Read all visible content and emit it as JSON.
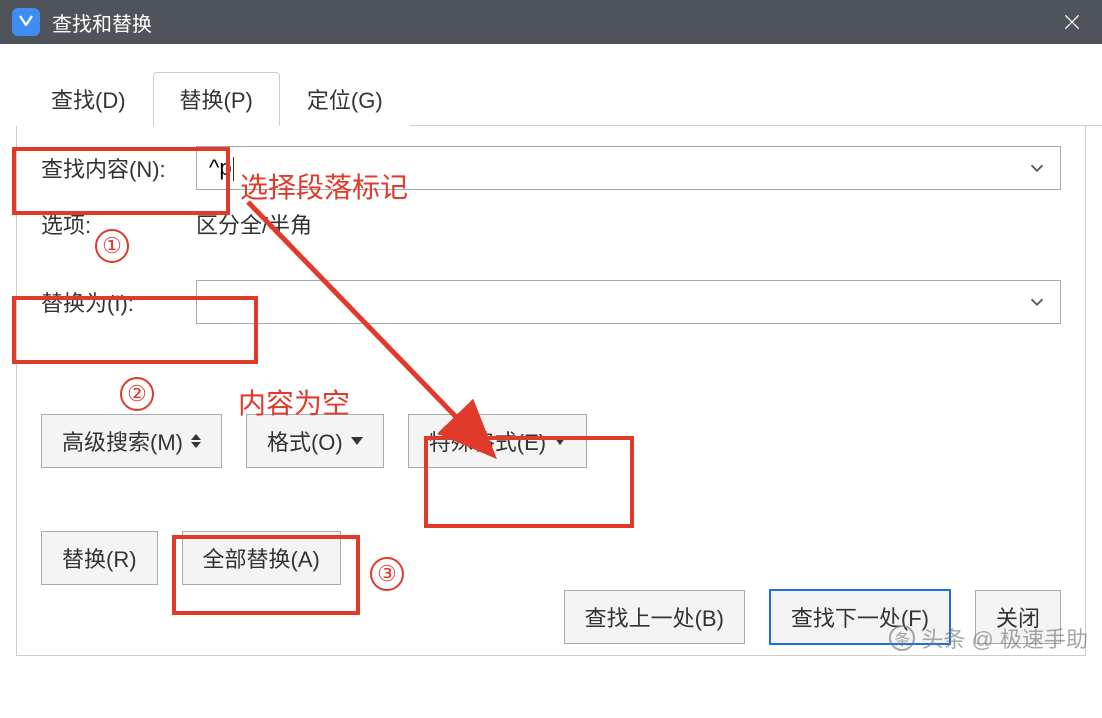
{
  "titlebar": {
    "title": "查找和替换"
  },
  "tabs": {
    "find": "查找(D)",
    "replace": "替换(P)",
    "goto": "定位(G)"
  },
  "labels": {
    "find_what": "查找内容(N):",
    "replace_with": "替换为(I):",
    "options": "选项:",
    "options_value": "区分全/半角"
  },
  "fields": {
    "find_value": "^p",
    "replace_value": ""
  },
  "buttons": {
    "advanced": "高级搜索(M)",
    "format": "格式(O)",
    "special": "特殊格式(E)",
    "replace": "替换(R)",
    "replace_all": "全部替换(A)",
    "find_prev": "查找上一处(B)",
    "find_next": "查找下一处(F)",
    "close": "关闭"
  },
  "annotations": {
    "hint1": "选择段落标记",
    "hint2": "内容为空",
    "num1": "①",
    "num2": "②",
    "num3": "③"
  },
  "watermark": "头条 @ 极速手助"
}
